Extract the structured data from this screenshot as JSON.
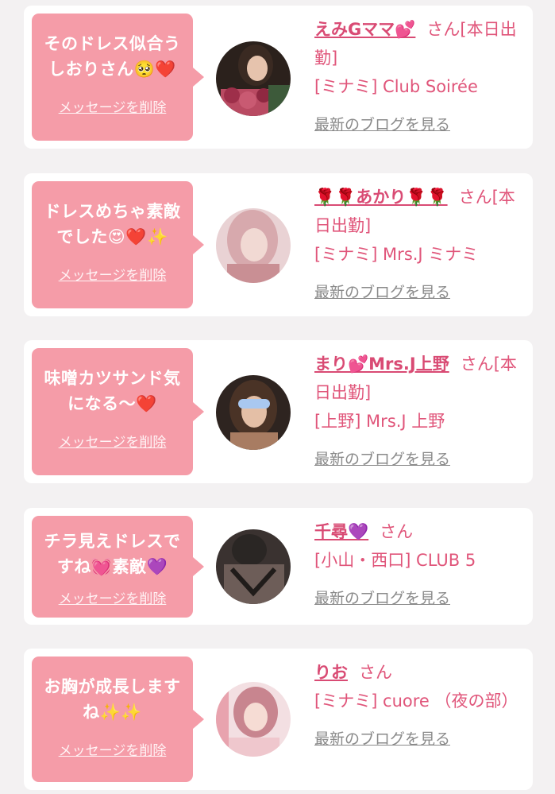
{
  "messages": [
    {
      "bubble_text": "そのドレス似合うしおりさん🥺❤️",
      "delete_label": "メッセージを削除",
      "cast_name": "えみGママ💕",
      "san": "さん",
      "status": "[本日出勤]",
      "shop": "[ミナミ] Club Soirée",
      "blog_link": "最新のブログを見る",
      "avatar_colors": [
        "#3a2a22",
        "#b94a62"
      ]
    },
    {
      "bubble_text": "ドレスめちゃ素敵でした😍❤️✨",
      "delete_label": "メッセージを削除",
      "cast_name": "🌹🌹あかり🌹🌹",
      "san": "さん",
      "status": "[本日出勤]",
      "shop": "[ミナミ] Mrs.J ミナミ",
      "blog_link": "最新のブログを見る",
      "avatar_colors": [
        "#e7c2c6",
        "#c98f94"
      ]
    },
    {
      "bubble_text": "味噌カツサンド気になる〜❤️",
      "delete_label": "メッセージを削除",
      "cast_name": "まり💕Mrs.J上野",
      "san": "さん",
      "status": "[本日出勤]",
      "shop": "[上野] Mrs.J 上野",
      "blog_link": "最新のブログを見る",
      "avatar_colors": [
        "#4a3326",
        "#a87c62"
      ]
    },
    {
      "bubble_text": "チラ見えドレスですね💓素敵💜",
      "delete_label": "メッセージを削除",
      "cast_name": "千尋💜",
      "san": "さん",
      "status": "",
      "shop": "[小山・西口] CLUB 5",
      "blog_link": "最新のブログを見る",
      "avatar_colors": [
        "#2a2624",
        "#6d5d58"
      ]
    },
    {
      "bubble_text": "お胸が成長しますね✨✨",
      "delete_label": "メッセージを削除",
      "cast_name": "りお",
      "san": "さん",
      "status": "",
      "shop": "[ミナミ] cuore （夜の部）",
      "blog_link": "最新のブログを見る",
      "avatar_colors": [
        "#efc7cd",
        "#c8858f"
      ]
    }
  ],
  "colors": {
    "background": "#f3f1f2",
    "bubble": "#f59ca8",
    "accent": "#d94b74",
    "link_gray": "#8a8a8a"
  }
}
